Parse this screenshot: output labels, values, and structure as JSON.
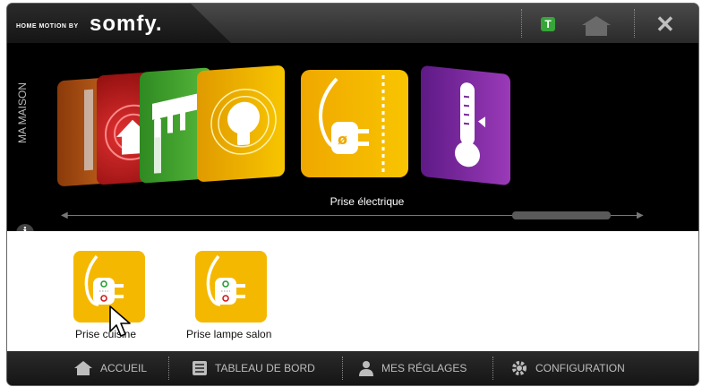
{
  "header": {
    "brand_prefix": "HOME MOTION BY",
    "brand_name": "somfy.",
    "badge_letter": "T",
    "home_icon": "home-icon",
    "close_icon": "close-icon"
  },
  "carousel": {
    "side_label": "MA MAISON",
    "selected_label": "Prise électrique",
    "tiles": [
      {
        "name": "window-tile",
        "icon": "window-icon",
        "color": "#b85a1a"
      },
      {
        "name": "alarm-tile",
        "icon": "alarm-icon",
        "color": "#c02020"
      },
      {
        "name": "awning-tile",
        "icon": "awning-icon",
        "color": "#3a9a2a"
      },
      {
        "name": "lighting-tile",
        "icon": "bulb-icon",
        "color": "#f2a900"
      },
      {
        "name": "plug-tile",
        "icon": "plug-icon",
        "color": "#f5b800"
      },
      {
        "name": "heating-tile",
        "icon": "thermometer-icon",
        "color": "#7a2a9a"
      }
    ]
  },
  "devices": [
    {
      "label": "Prise cuisine",
      "icon": "plug-icon"
    },
    {
      "label": "Prise lampe salon",
      "icon": "plug-icon"
    }
  ],
  "nav": {
    "home": "ACCUEIL",
    "dashboard": "TABLEAU DE BORD",
    "settings": "MES RÉGLAGES",
    "configuration": "CONFIGURATION"
  },
  "colors": {
    "accent_yellow": "#f5b800",
    "badge_green": "#37a53a",
    "background": "#000000"
  }
}
